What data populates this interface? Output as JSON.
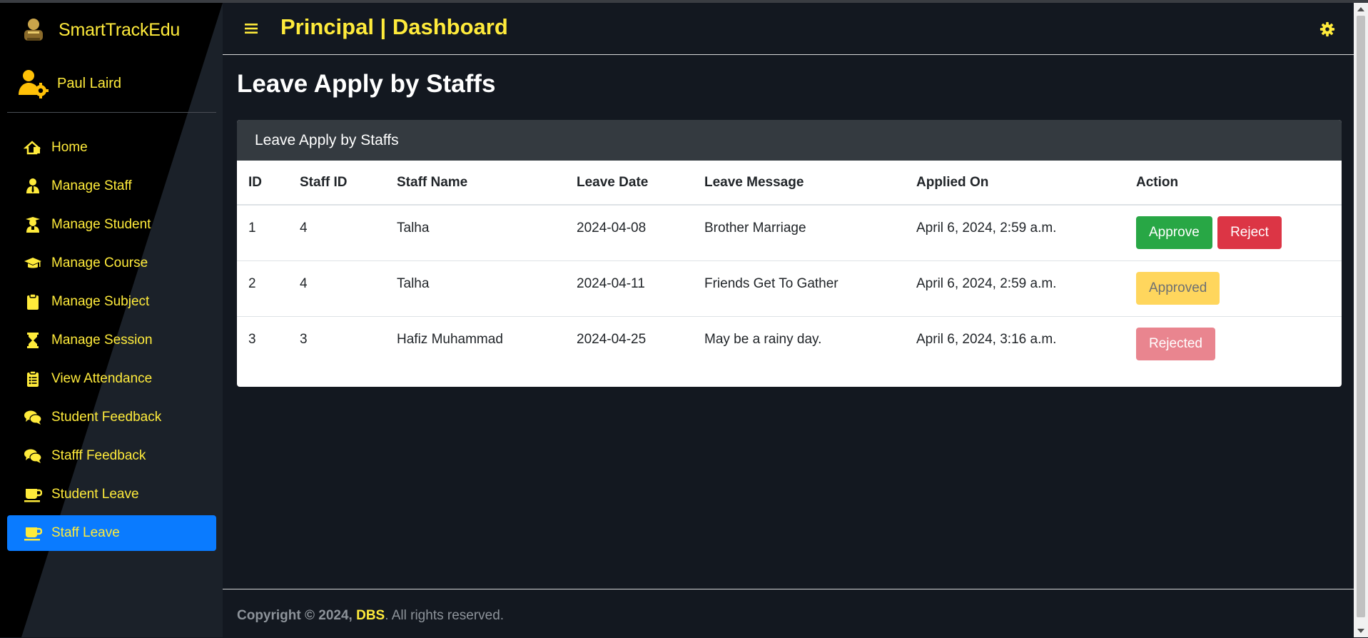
{
  "app": {
    "brand": "SmartTrackEdu",
    "user": "Paul Laird"
  },
  "header": {
    "title": "Principal | Dashboard"
  },
  "sidebar": {
    "items": [
      {
        "label": "Home",
        "icon": "home-icon"
      },
      {
        "label": "Manage Staff",
        "icon": "user-tie-icon"
      },
      {
        "label": "Manage Student",
        "icon": "user-graduate-icon"
      },
      {
        "label": "Manage Course",
        "icon": "graduation-cap-icon"
      },
      {
        "label": "Manage Subject",
        "icon": "clipboard-icon"
      },
      {
        "label": "Manage Session",
        "icon": "hourglass-icon"
      },
      {
        "label": "View Attendance",
        "icon": "clipboard-list-icon"
      },
      {
        "label": "Student Feedback",
        "icon": "comments-icon"
      },
      {
        "label": "Stafff Feedback",
        "icon": "comments-icon"
      },
      {
        "label": "Student Leave",
        "icon": "mug-icon"
      },
      {
        "label": "Staff Leave",
        "icon": "mug-icon",
        "active": true
      }
    ]
  },
  "main": {
    "page_title": "Leave Apply by Staffs",
    "card_title": "Leave Apply by Staffs",
    "table": {
      "columns": [
        "ID",
        "Staff ID",
        "Staff Name",
        "Leave Date",
        "Leave Message",
        "Applied On",
        "Action"
      ],
      "rows": [
        {
          "id": "1",
          "staff_id": "4",
          "staff_name": "Talha",
          "leave_date": "2024-04-08",
          "message": "Brother Marriage",
          "applied_on": "April 6, 2024, 2:59 a.m.",
          "approve_label": "Approve",
          "reject_label": "Reject"
        },
        {
          "id": "2",
          "staff_id": "4",
          "staff_name": "Talha",
          "leave_date": "2024-04-11",
          "message": "Friends Get To Gather",
          "applied_on": "April 6, 2024, 2:59 a.m.",
          "status_label": "Approved"
        },
        {
          "id": "3",
          "staff_id": "3",
          "staff_name": "Hafiz Muhammad",
          "leave_date": "2024-04-25",
          "message": "May be a rainy day.",
          "applied_on": "April 6, 2024, 3:16 a.m.",
          "status_label": "Rejected"
        }
      ]
    }
  },
  "footer": {
    "prefix": "Copyright © 2024,",
    "brand": "DBS",
    "suffix": ". All rights reserved."
  },
  "colors": {
    "accent": "#ffeb3b",
    "active": "#0a7bff",
    "success": "#28a745",
    "danger": "#dc3545",
    "warning": "#ffc107"
  }
}
